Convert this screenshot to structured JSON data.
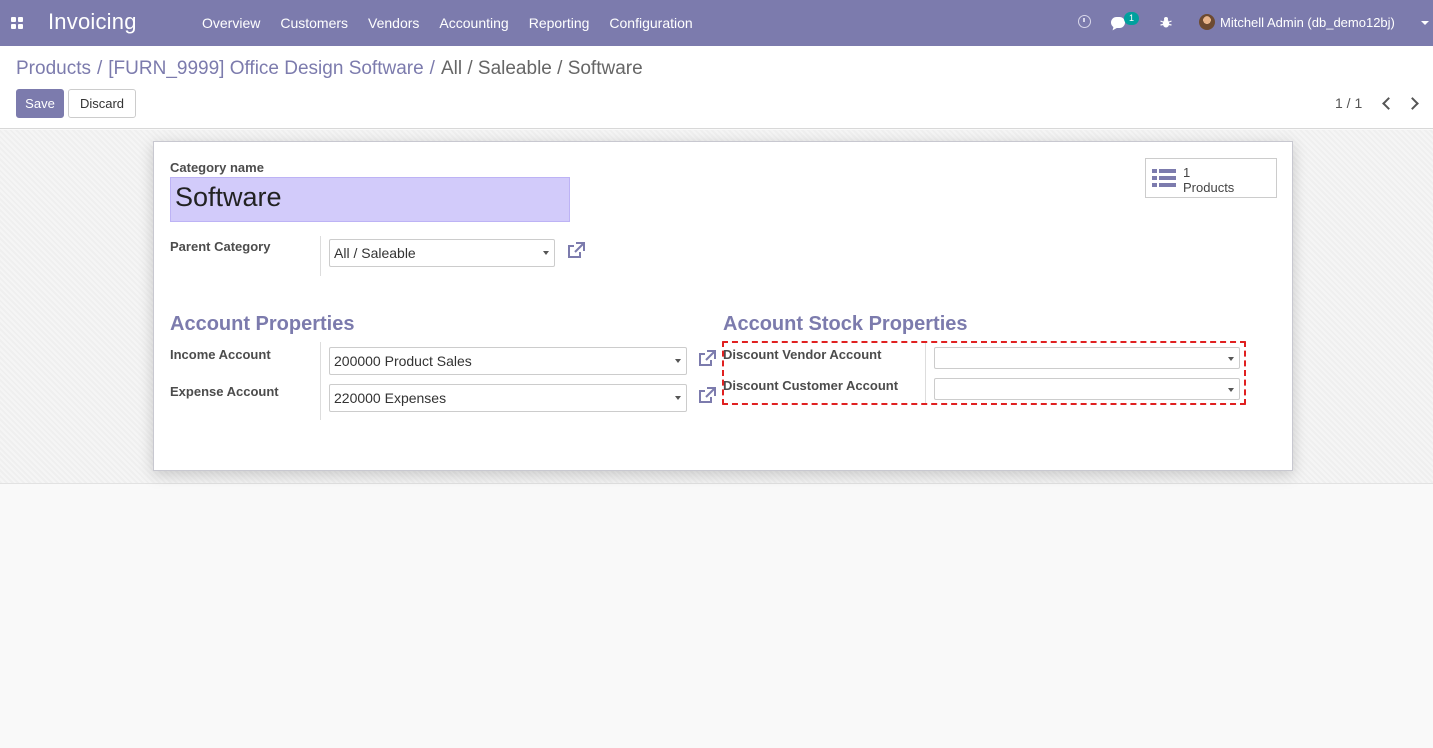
{
  "navbar": {
    "brand": "Invoicing",
    "menu": [
      "Overview",
      "Customers",
      "Vendors",
      "Accounting",
      "Reporting",
      "Configuration"
    ],
    "chat_count": "1",
    "user": "Mitchell Admin (db_demo12bj)"
  },
  "breadcrumb": {
    "items": [
      "Products",
      "[FURN_9999] Office Design Software"
    ],
    "last": "All / Saleable / Software"
  },
  "buttons": {
    "save": "Save",
    "discard": "Discard"
  },
  "pager": {
    "value": "1 / 1"
  },
  "form": {
    "category_name_label": "Category name",
    "category_name": "Software",
    "parent_category_label": "Parent Category",
    "parent_category": "All / Saleable",
    "stat_button": {
      "value": "1",
      "label": "Products"
    },
    "account_properties": {
      "title": "Account Properties",
      "income_label": "Income Account",
      "income_value": "200000 Product Sales",
      "expense_label": "Expense Account",
      "expense_value": "220000 Expenses"
    },
    "stock_properties": {
      "title": "Account Stock Properties",
      "vendor_label": "Discount Vendor Account",
      "vendor_value": "",
      "customer_label": "Discount Customer Account",
      "customer_value": ""
    }
  },
  "colors": {
    "brand": "#7c7bad",
    "highlight": "#e02020",
    "name_field": "#d2cbfa"
  }
}
